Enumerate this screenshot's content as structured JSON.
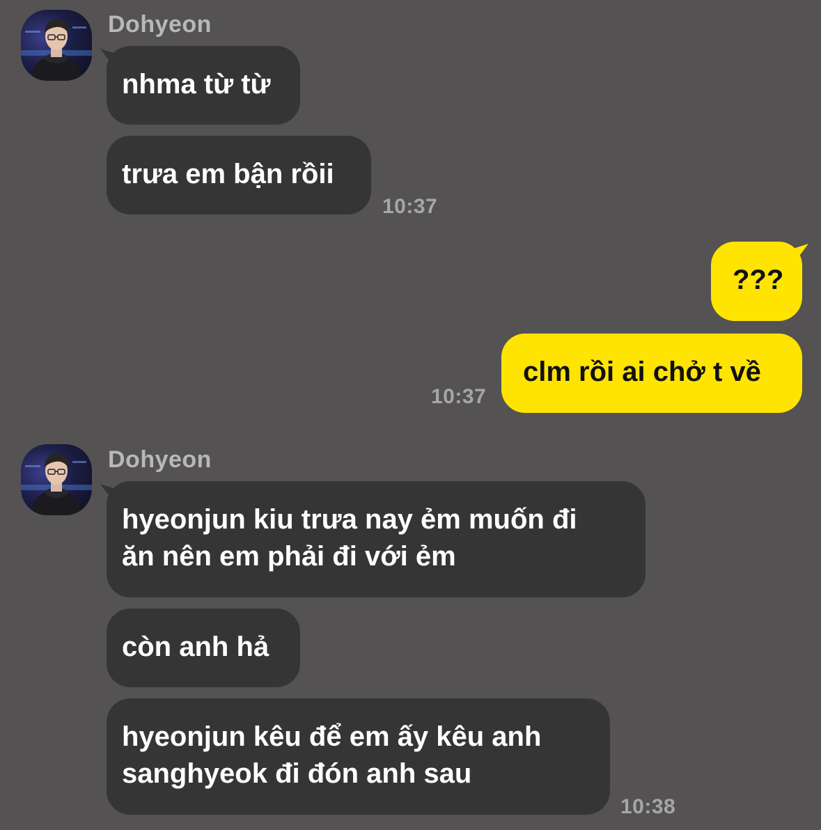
{
  "conversation": {
    "groups": [
      {
        "sender": "Dohyeon",
        "messages": [
          "nhma từ từ",
          "trưa em bận rồii"
        ],
        "time": "10:37"
      },
      {
        "sender": "me",
        "messages": [
          "???",
          "clm rồi ai chở t về"
        ],
        "time": "10:37"
      },
      {
        "sender": "Dohyeon",
        "messages": [
          "hyeonjun kiu trưa nay ẻm muốn đi\năn nên em phải đi với ẻm",
          "còn anh hả",
          "hyeonjun kêu để em ấy kêu anh\nsanghyeok đi đón anh sau"
        ],
        "time": "10:38"
      }
    ]
  },
  "colors": {
    "background": "#545253",
    "incoming_bubble": "#363536",
    "outgoing_bubble": "#ffe401",
    "name_text": "#b9b8b9",
    "time_text": "#a7a6a7"
  },
  "icons": {
    "avatar": "profile-photo"
  }
}
